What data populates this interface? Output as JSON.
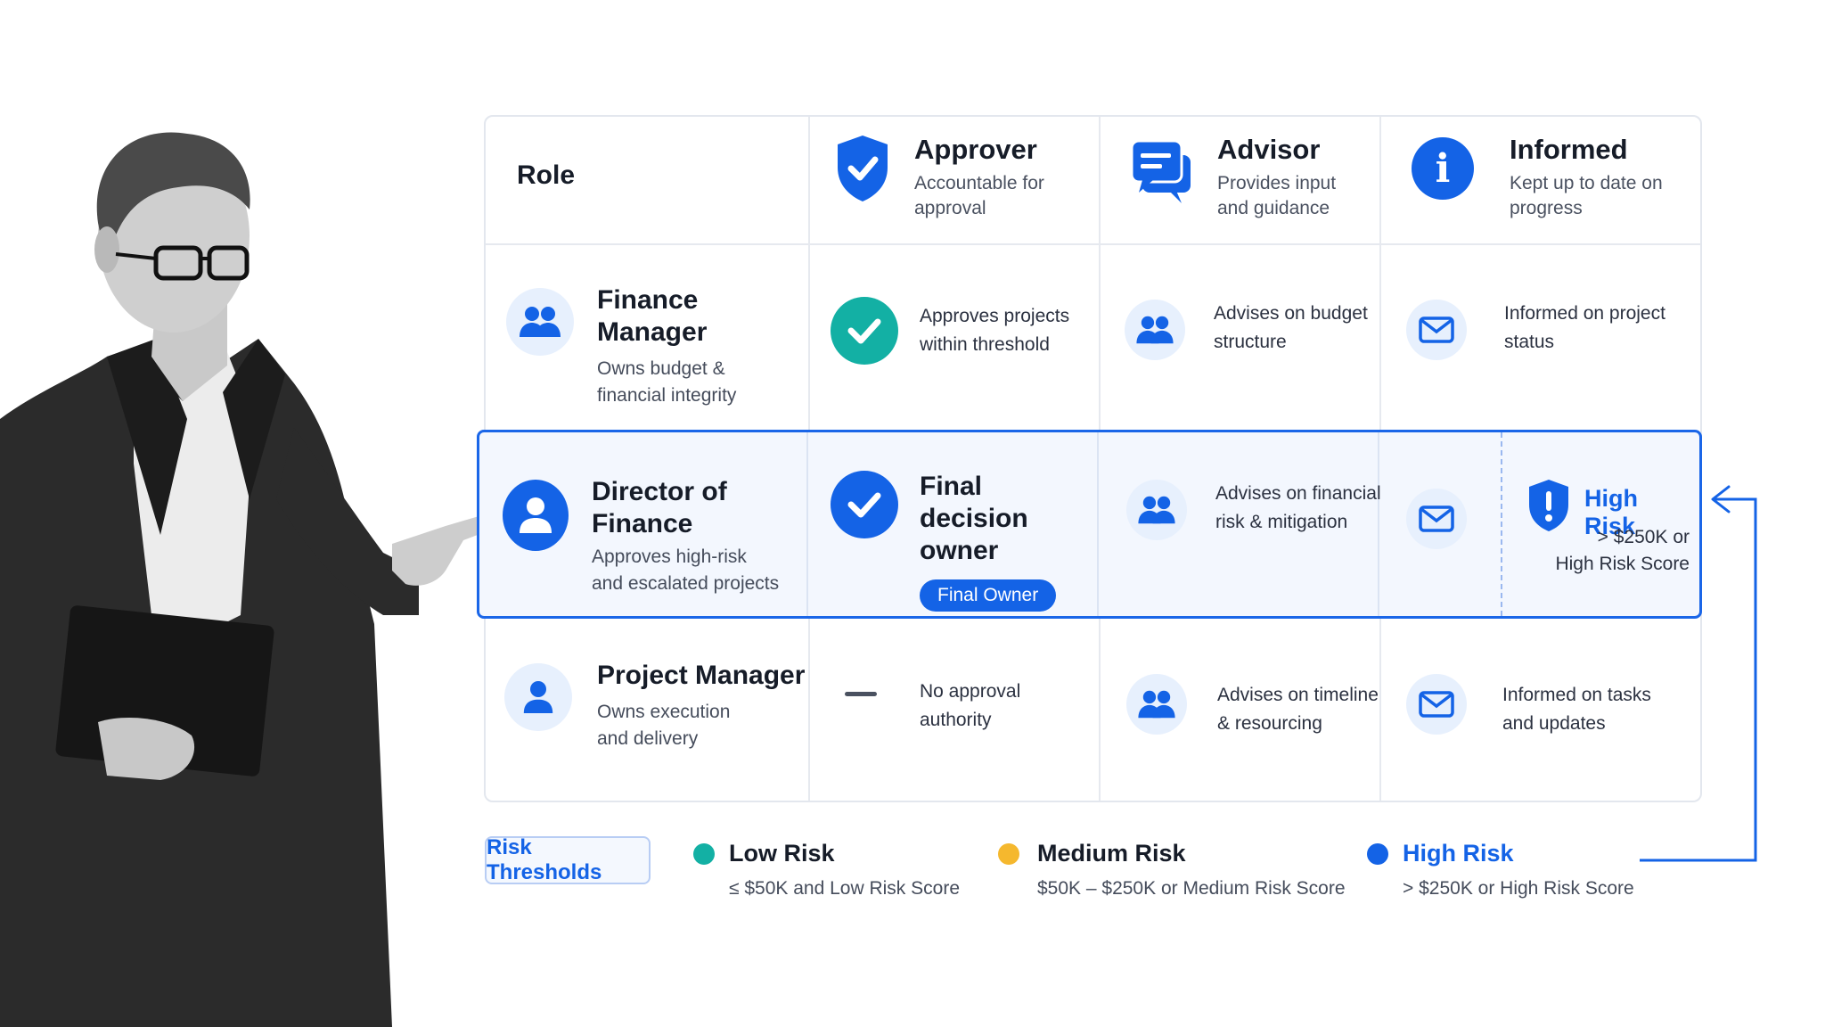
{
  "header": {
    "role_label": "Role",
    "columns": [
      {
        "title": "Approver",
        "subtitle_lines": [
          "Accountable for",
          "approval"
        ],
        "icon": "shield-check-icon"
      },
      {
        "title": "Advisor",
        "subtitle_lines": [
          "Provides input",
          "and guidance"
        ],
        "icon": "chat-bubbles-icon"
      },
      {
        "title": "Informed",
        "subtitle_lines": [
          "Kept up to date on",
          "progress"
        ],
        "icon": "info-icon"
      }
    ]
  },
  "rows": [
    {
      "role": "Finance Manager",
      "role_sub": [
        "Owns budget &",
        "financial integrity"
      ],
      "approver": [
        "Approves projects",
        "within threshold"
      ],
      "advisor": [
        "Advises on budget",
        "structure"
      ],
      "informed": [
        "Informed on project",
        "status"
      ]
    },
    {
      "role": "Director of Finance",
      "role_sub": [
        "Approves high-risk",
        "and escalated projects"
      ],
      "approver": [
        "Final decision",
        "owner"
      ],
      "badge": "Final Owner",
      "advisor": [
        "Advises on financial",
        "risk & mitigation"
      ],
      "high_risk": {
        "title": "High Risk",
        "lines": [
          "> $250K or",
          "High Risk Score"
        ]
      }
    },
    {
      "role": "Project Manager",
      "role_sub": [
        "Owns execution",
        "and delivery"
      ],
      "approver": [
        "No approval",
        "authority"
      ],
      "advisor": [
        "Advises on timeline",
        "& resourcing"
      ],
      "informed": [
        "Informed on tasks",
        "and updates"
      ]
    }
  ],
  "legend": {
    "button": "Risk Thresholds",
    "items": [
      {
        "title": "Low Risk",
        "desc": "≤ $50K and Low Risk Score",
        "color": "#13b0a4"
      },
      {
        "title": "Medium Risk",
        "desc": "$50K – $250K or Medium Risk Score",
        "color": "#f5b82e"
      },
      {
        "title": "High Risk",
        "desc": "> $250K or High Risk Score",
        "color": "#1463e6"
      }
    ]
  },
  "colors": {
    "accent": "#1463e6",
    "teal": "#13b0a4",
    "amber": "#f5b82e"
  }
}
